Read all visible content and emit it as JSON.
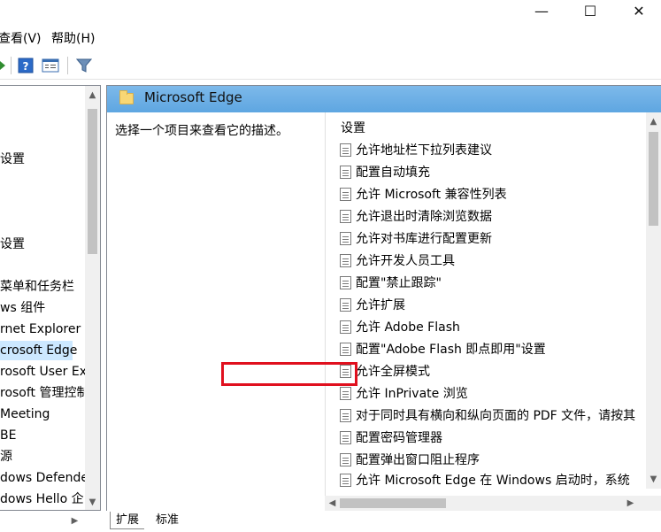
{
  "window": {
    "minimize_glyph": "—",
    "maximize_glyph": "☐",
    "close_glyph": "✕"
  },
  "menu": {
    "view": "查看(V)",
    "help": "帮助(H)"
  },
  "toolbar": {
    "icons": [
      "forward-arrow-icon",
      "help-icon",
      "properties-icon",
      "filter-icon"
    ]
  },
  "tree": {
    "items": [
      {
        "label": "设置",
        "selected": false
      },
      {
        "label": "设置",
        "selected": false
      },
      {
        "label": "菜单和任务栏",
        "selected": false
      },
      {
        "label": "ws 组件",
        "selected": false
      },
      {
        "label": "rnet Explorer",
        "selected": false
      },
      {
        "label": "crosoft Edge",
        "selected": true
      },
      {
        "label": "rosoft User Ex",
        "selected": false
      },
      {
        "label": "rosoft 管理控制",
        "selected": false
      },
      {
        "label": "Meeting",
        "selected": false
      },
      {
        "label": "BE",
        "selected": false
      },
      {
        "label": "源",
        "selected": false
      },
      {
        "label": "dows Defende",
        "selected": false
      },
      {
        "label": "dows Hello 企",
        "selected": false
      }
    ]
  },
  "details": {
    "title": "Microsoft Edge",
    "description": "选择一个项目来查看它的描述。",
    "settings_header": "设置",
    "settings": [
      "允许地址栏下拉列表建议",
      "配置自动填充",
      "允许 Microsoft 兼容性列表",
      "允许退出时清除浏览数据",
      "允许对书库进行配置更新",
      "允许开发人员工具",
      "配置\"禁止跟踪\"",
      "允许扩展",
      "允许 Adobe Flash",
      "配置\"Adobe Flash 即点即用\"设置",
      "允许全屏模式",
      "允许 InPrivate 浏览",
      "对于同时具有横向和纵向页面的 PDF 文件，请按其",
      "配置密码管理器",
      "配置弹出窗口阻止程序",
      "允许 Microsoft Edge 在 Windows 启动时，系统"
    ],
    "highlight_color": "#e0101e"
  },
  "tabs": {
    "extended": "扩展",
    "standard": "标准"
  }
}
